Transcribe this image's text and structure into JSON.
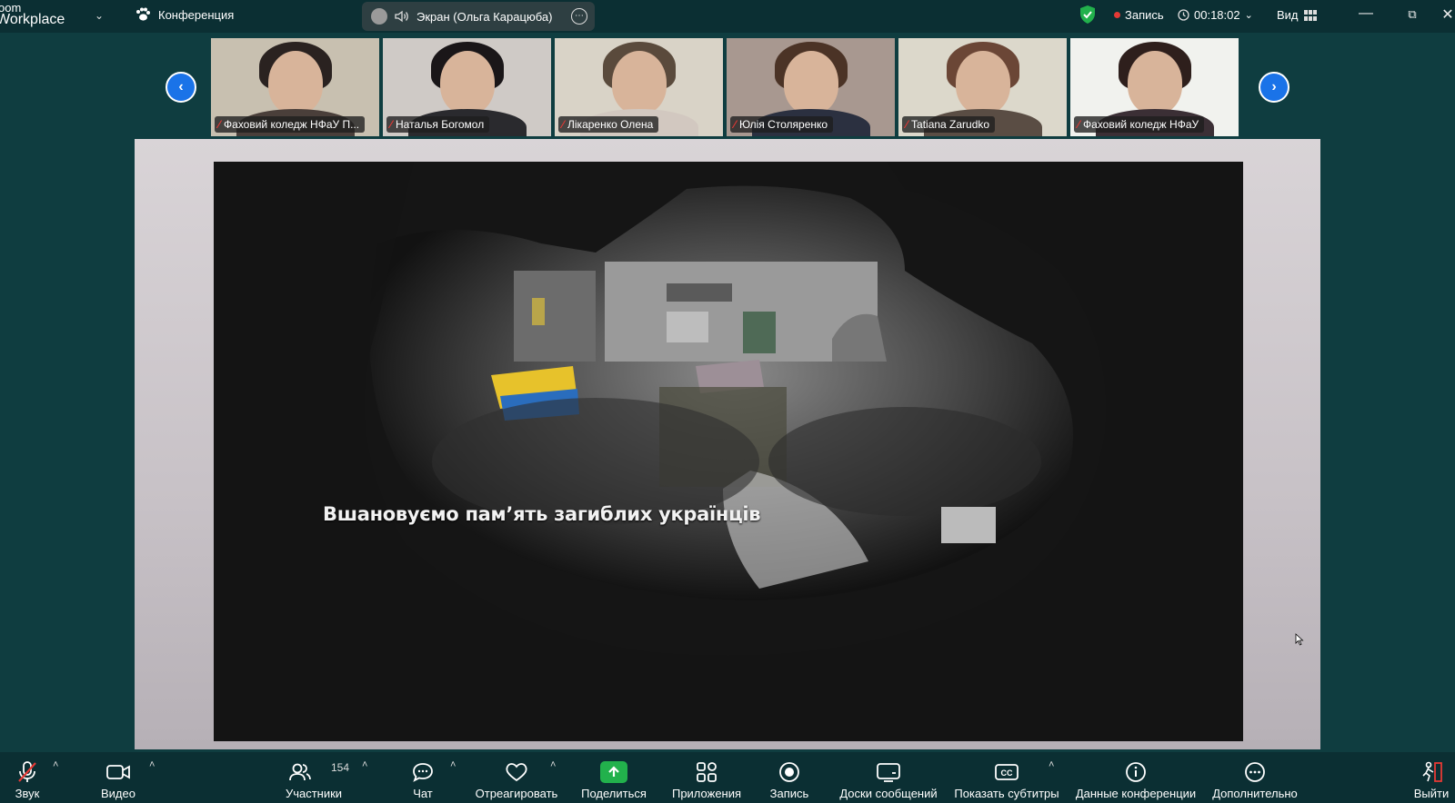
{
  "app": {
    "title_line1": "oom",
    "title_line2": "Workplace"
  },
  "topbar": {
    "conference_label": "Конференция",
    "share_label": "Экран (Ольга Карацюба)",
    "recording_label": "Запись",
    "timer": "00:18:02",
    "view_label": "Вид"
  },
  "thumbnails": [
    {
      "name": "Фаховий коледж НФаУ П...",
      "bg": "#c8c0b0",
      "hair": "#2a2220",
      "body": "#4a3f3a"
    },
    {
      "name": "Наталья Богомол",
      "bg": "#cfcac6",
      "hair": "#1a1618",
      "body": "#2a2a2e"
    },
    {
      "name": "Лікаренко Олена",
      "bg": "#d9d3c7",
      "hair": "#5a4a3c",
      "body": "#d2c8c0"
    },
    {
      "name": "Юлія Столяренко",
      "bg": "#a89890",
      "hair": "#4b3326",
      "body": "#2b3040"
    },
    {
      "name": "Tatiana Zarudko",
      "bg": "#dcd8cb",
      "hair": "#6b4636",
      "body": "#5a4d44"
    },
    {
      "name": "Фаховий коледж НФаУ",
      "bg": "#f1f2ee",
      "hair": "#2e1f1c",
      "body": "#3b2f35"
    }
  ],
  "shared_screen": {
    "caption": "Вшановуємо пам’ять загиблих українців"
  },
  "toolbar": {
    "audio_label": "Звук",
    "video_label": "Видео",
    "participants_label": "Участники",
    "participants_count": "154",
    "chat_label": "Чат",
    "react_label": "Отреагировать",
    "share_label": "Поделиться",
    "apps_label": "Приложения",
    "record_label": "Запись",
    "whiteboards_label": "Доски сообщений",
    "captions_label": "Показать субтитры",
    "info_label": "Данные конференции",
    "more_label": "Дополнительно",
    "leave_label": "Выйти"
  },
  "colors": {
    "background": "#0f3d40",
    "bar": "#0b2f33",
    "accent_blue": "#1a73e8",
    "share_green": "#22b14c",
    "record_red": "#e53935"
  }
}
